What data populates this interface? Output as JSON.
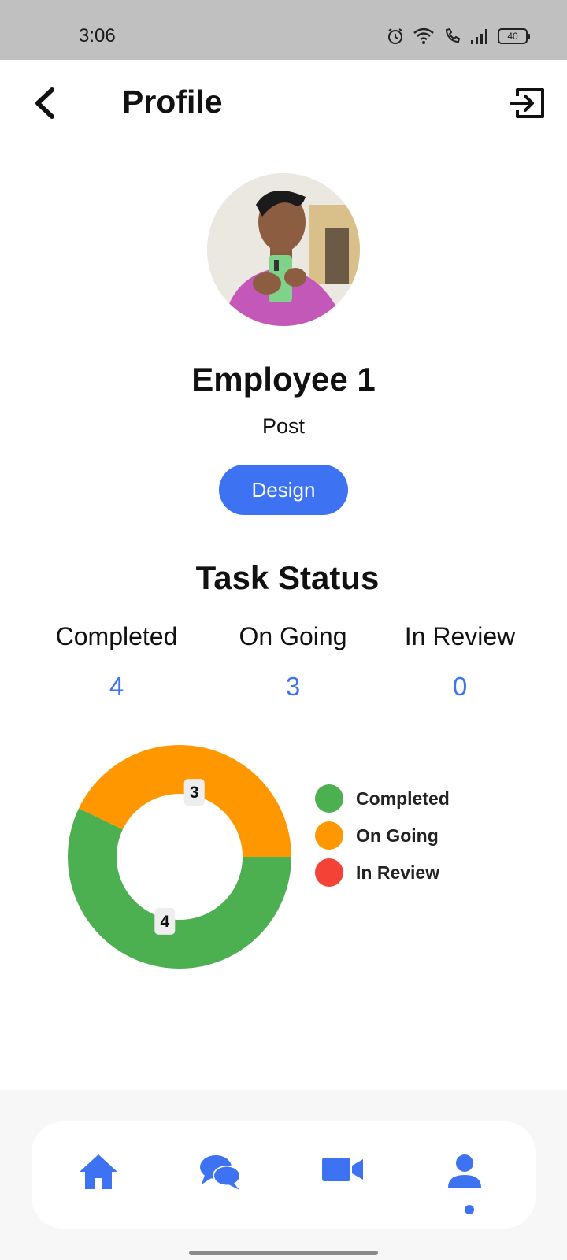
{
  "status_bar": {
    "time": "3:06",
    "battery": "40"
  },
  "header": {
    "title": "Profile",
    "back_icon": "chevron-left-icon",
    "logout_icon": "logout-icon"
  },
  "profile": {
    "name": "Employee 1",
    "post": "Post",
    "department": "Design"
  },
  "task_status": {
    "title": "Task Status",
    "stats": [
      {
        "label": "Completed",
        "value": "4"
      },
      {
        "label": "On Going",
        "value": "3"
      },
      {
        "label": "In Review",
        "value": "0"
      }
    ]
  },
  "chart_data": {
    "type": "pie",
    "variant": "donut",
    "categories": [
      "Completed",
      "On Going",
      "In Review"
    ],
    "values": [
      4,
      3,
      0
    ],
    "colors": [
      "#4caf50",
      "#ff9800",
      "#f44336"
    ],
    "data_labels": [
      "4",
      "3",
      ""
    ],
    "legend_position": "right"
  },
  "bottom_nav": {
    "items": [
      {
        "icon": "home-icon"
      },
      {
        "icon": "chat-icon"
      },
      {
        "icon": "video-icon"
      },
      {
        "icon": "person-icon"
      }
    ],
    "active_index": 3
  },
  "colors": {
    "accent": "#3d72f2"
  }
}
